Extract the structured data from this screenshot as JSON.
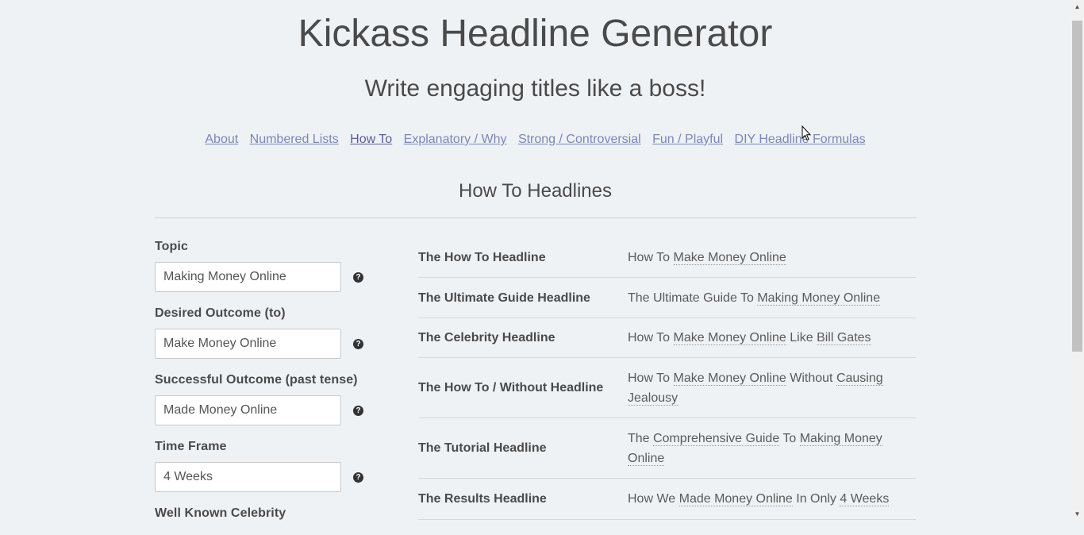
{
  "header": {
    "title": "Kickass Headline Generator",
    "subtitle": "Write engaging titles like a boss!"
  },
  "nav": {
    "items": [
      {
        "label": "About"
      },
      {
        "label": "Numbered Lists"
      },
      {
        "label": "How To",
        "active": true
      },
      {
        "label": "Explanatory / Why"
      },
      {
        "label": "Strong / Controversial"
      },
      {
        "label": "Fun / Playful"
      },
      {
        "label": "DIY Headline Formulas"
      }
    ]
  },
  "section": {
    "title": "How To Headlines"
  },
  "form": {
    "fields": [
      {
        "label": "Topic",
        "value": "Making Money Online"
      },
      {
        "label": "Desired Outcome (to)",
        "value": "Make Money Online"
      },
      {
        "label": "Successful Outcome (past tense)",
        "value": "Made Money Online"
      },
      {
        "label": "Time Frame",
        "value": "4 Weeks"
      },
      {
        "label": "Well Known Celebrity",
        "value": ""
      }
    ],
    "help_icon": "?"
  },
  "results": [
    {
      "name": "The How To Headline",
      "parts": [
        "How To ",
        "Make Money Online"
      ]
    },
    {
      "name": "The Ultimate Guide Headline",
      "parts": [
        "The Ultimate Guide To ",
        "Making Money Online"
      ]
    },
    {
      "name": "The Celebrity Headline",
      "parts": [
        "How To ",
        "Make Money Online",
        " Like ",
        "Bill Gates"
      ]
    },
    {
      "name": "The How To / Without Headline",
      "parts": [
        "How To ",
        "Make Money Online",
        " Without ",
        "Causing Jealousy"
      ]
    },
    {
      "name": "The Tutorial Headline",
      "parts": [
        "The ",
        "Comprehensive Guide",
        " To ",
        "Making Money Online"
      ]
    },
    {
      "name": "The Results Headline",
      "parts": [
        "How We ",
        "Made Money Online",
        " In Only ",
        "4 Weeks"
      ]
    }
  ],
  "colors": {
    "background": "#eff2f5",
    "link": "#7a86b8",
    "text": "#4a4a4a"
  }
}
